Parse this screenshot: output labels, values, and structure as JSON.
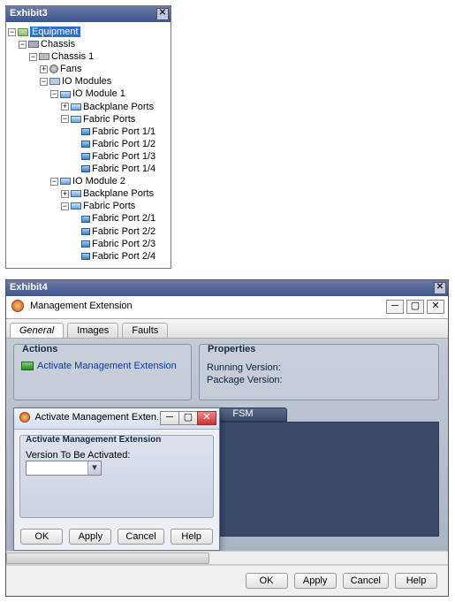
{
  "exhibit3": {
    "title": "Exhibit3",
    "tree": {
      "equipment": "Equipment",
      "chassis_group": "Chassis",
      "chassis1": "Chassis 1",
      "fans": "Fans",
      "io_modules": "IO Modules",
      "io_mod1": "IO Module 1",
      "backplane1": "Backplane Ports",
      "fabric1": "Fabric Ports",
      "fp11": "Fabric Port 1/1",
      "fp12": "Fabric Port 1/2",
      "fp13": "Fabric Port 1/3",
      "fp14": "Fabric Port 1/4",
      "io_mod2": "IO Module 2",
      "backplane2": "Backplane Ports",
      "fabric2": "Fabric Ports",
      "fp21": "Fabric Port 2/1",
      "fp22": "Fabric Port 2/2",
      "fp23": "Fabric Port 2/3",
      "fp24": "Fabric Port 2/4"
    }
  },
  "exhibit4": {
    "title": "Exhibit4",
    "window_title": "Management Extension",
    "tabs": {
      "general": "General",
      "images": "Images",
      "faults": "Faults"
    },
    "actions": {
      "title": "Actions",
      "activate": "Activate Management Extension"
    },
    "properties": {
      "title": "Properties",
      "running": "Running Version:",
      "package": "Package Version:"
    },
    "fsm": "FSM",
    "dialog": {
      "title": "Activate Management Exten...",
      "group_title": "Activate Management Extension",
      "field_label": "Version To Be Activated:",
      "ok": "OK",
      "apply": "Apply",
      "cancel": "Cancel",
      "help": "Help"
    },
    "buttons": {
      "ok": "OK",
      "apply": "Apply",
      "cancel": "Cancel",
      "help": "Help"
    }
  }
}
